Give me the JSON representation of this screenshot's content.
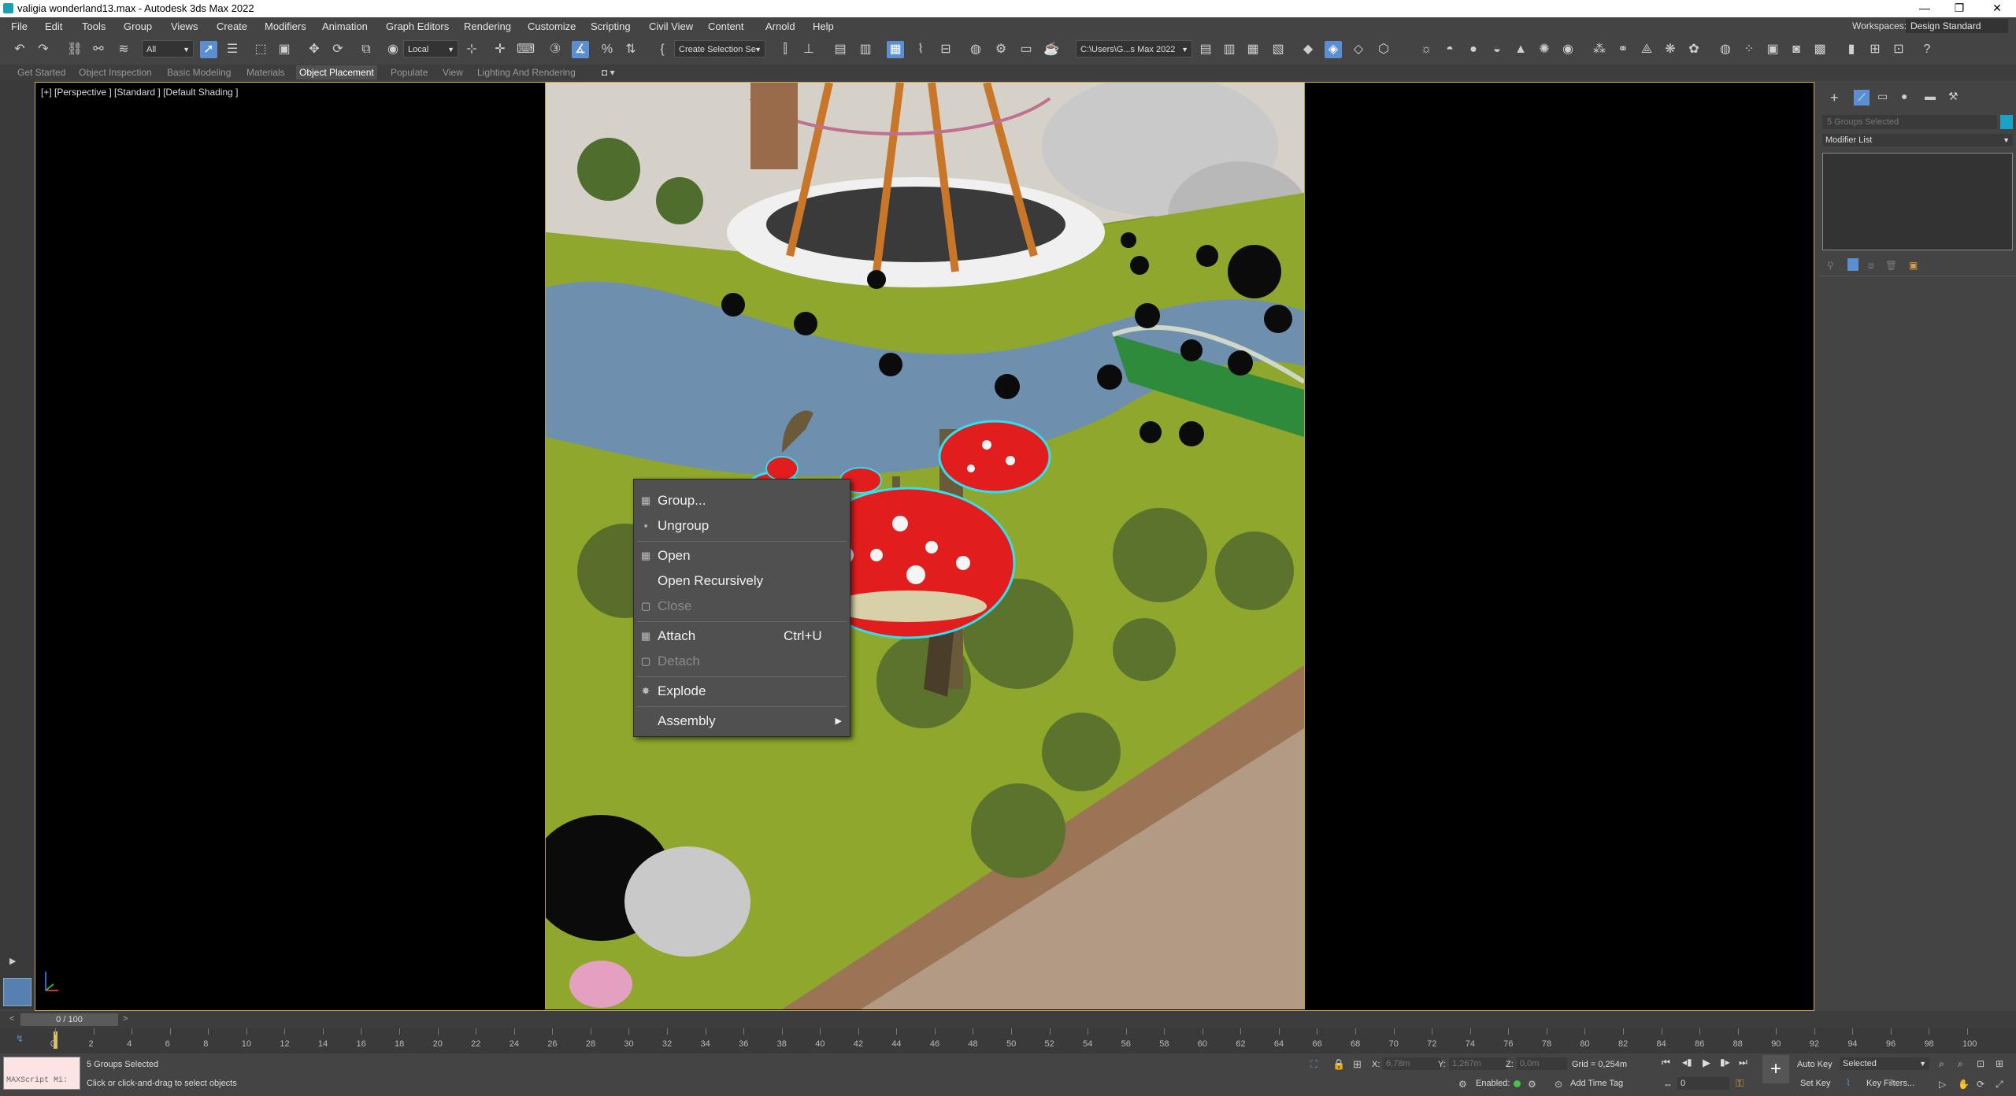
{
  "window": {
    "title": "valigia wonderland13.max - Autodesk 3ds Max 2022",
    "controls": [
      "—",
      "❐",
      "✕"
    ]
  },
  "menu": {
    "items": [
      "File",
      "Edit",
      "Tools",
      "Group",
      "Views",
      "Create",
      "Modifiers",
      "Animation",
      "Graph Editors",
      "Rendering",
      "Customize",
      "Scripting",
      "Civil View",
      "Content",
      "Arnold",
      "Help"
    ],
    "workspaces_label": "Workspaces:",
    "workspace_value": "Design Standard"
  },
  "toolbar": {
    "selection_filter": "All",
    "ref_coord": "Local",
    "selection_set": "Create Selection Se",
    "project_path": "C:\\Users\\G...s Max 2022"
  },
  "ribbon": {
    "tabs": [
      "Get Started",
      "Object Inspection",
      "Basic Modeling",
      "Materials",
      "Object Placement",
      "Populate",
      "View",
      "Lighting And Rendering"
    ],
    "active_tab": "Object Placement"
  },
  "viewport": {
    "label": "[+] [Perspective ] [Standard ] [Default Shading ]"
  },
  "context_menu": {
    "items": [
      {
        "label": "Group...",
        "icon": "group-icon",
        "enabled": true,
        "shortcut": ""
      },
      {
        "label": "Ungroup",
        "icon": "ungroup-icon",
        "enabled": true,
        "shortcut": ""
      },
      {
        "label": "Open",
        "icon": "open-group-icon",
        "enabled": true,
        "shortcut": ""
      },
      {
        "label": "Open Recursively",
        "icon": "",
        "enabled": true,
        "shortcut": ""
      },
      {
        "label": "Close",
        "icon": "close-group-icon",
        "enabled": false,
        "shortcut": ""
      },
      {
        "label": "Attach",
        "icon": "attach-icon",
        "enabled": true,
        "shortcut": "Ctrl+U"
      },
      {
        "label": "Detach",
        "icon": "detach-icon",
        "enabled": false,
        "shortcut": ""
      },
      {
        "label": "Explode",
        "icon": "explode-icon",
        "enabled": true,
        "shortcut": ""
      },
      {
        "label": "Assembly",
        "icon": "",
        "enabled": true,
        "shortcut": "",
        "submenu": true
      }
    ]
  },
  "command_panel": {
    "selection_name": "5 Groups Selected",
    "modifier_list": "Modifier List",
    "accent_color": "#1aa3c7"
  },
  "timeline": {
    "frame_display": "0 / 100",
    "ticks": [
      "0",
      "2",
      "4",
      "6",
      "8",
      "10",
      "12",
      "14",
      "16",
      "18",
      "20",
      "22",
      "24",
      "26",
      "28",
      "30",
      "32",
      "34",
      "36",
      "38",
      "40",
      "42",
      "44",
      "46",
      "48",
      "50",
      "52",
      "54",
      "56",
      "58",
      "60",
      "62",
      "64",
      "66",
      "68",
      "70",
      "72",
      "74",
      "76",
      "78",
      "80",
      "82",
      "84",
      "86",
      "88",
      "90",
      "92",
      "94",
      "96",
      "98",
      "100"
    ]
  },
  "status": {
    "maxscript": "MAXScript Mi:",
    "selection_count": "5 Groups Selected",
    "prompt": "Click or click-and-drag to select objects",
    "x_label": "X:",
    "x_value": "6,78m",
    "y_label": "Y:",
    "y_value": "1,267m",
    "z_label": "Z:",
    "z_value": "0,0m",
    "grid": "Grid = 0,254m",
    "enabled_label": "Enabled:",
    "add_time_tag": "Add Time Tag",
    "auto_key": "Auto Key",
    "set_key": "Set Key",
    "key_mode": "Selected",
    "key_filters": "Key Filters...",
    "frame_field": "0"
  }
}
